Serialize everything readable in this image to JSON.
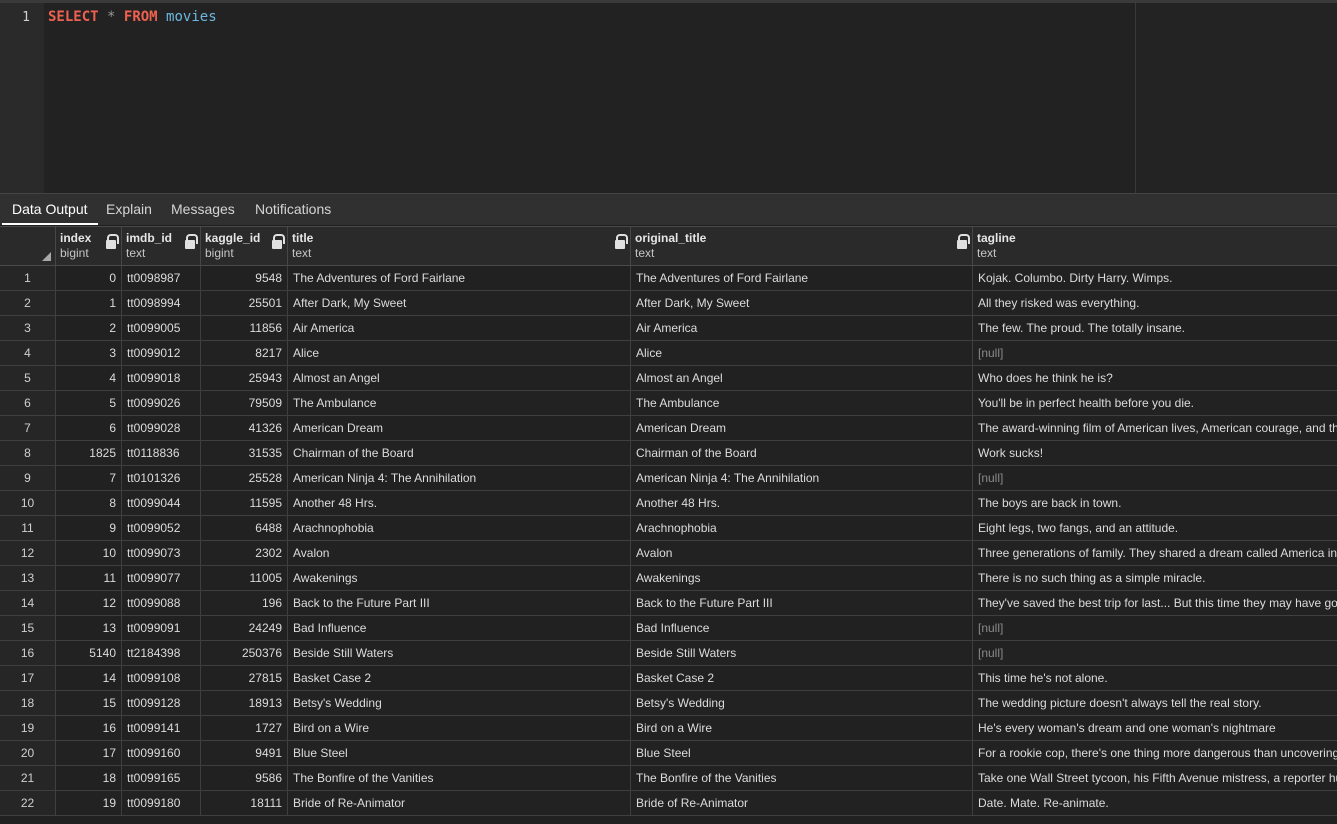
{
  "editor": {
    "line_number": "1",
    "keyword_select": "SELECT",
    "operator_star": "*",
    "keyword_from": "FROM",
    "table_name": "movies"
  },
  "tabs": [
    {
      "label": "Data Output",
      "active": true
    },
    {
      "label": "Explain",
      "active": false
    },
    {
      "label": "Messages",
      "active": false
    },
    {
      "label": "Notifications",
      "active": false
    }
  ],
  "columns": [
    {
      "name": "index",
      "type": "bigint",
      "locked": true
    },
    {
      "name": "imdb_id",
      "type": "text",
      "locked": true
    },
    {
      "name": "kaggle_id",
      "type": "bigint",
      "locked": true
    },
    {
      "name": "title",
      "type": "text",
      "locked": true
    },
    {
      "name": "original_title",
      "type": "text",
      "locked": true
    },
    {
      "name": "tagline",
      "type": "text",
      "locked": false
    }
  ],
  "null_label": "[null]",
  "rows": [
    {
      "n": "1",
      "index": "0",
      "imdb_id": "tt0098987",
      "kaggle_id": "9548",
      "title": "The Adventures of Ford Fairlane",
      "original_title": "The Adventures of Ford Fairlane",
      "tagline": "Kojak. Columbo. Dirty Harry. Wimps."
    },
    {
      "n": "2",
      "index": "1",
      "imdb_id": "tt0098994",
      "kaggle_id": "25501",
      "title": "After Dark, My Sweet",
      "original_title": "After Dark, My Sweet",
      "tagline": "All they risked was everything."
    },
    {
      "n": "3",
      "index": "2",
      "imdb_id": "tt0099005",
      "kaggle_id": "11856",
      "title": "Air America",
      "original_title": "Air America",
      "tagline": "The few. The proud. The totally insane."
    },
    {
      "n": "4",
      "index": "3",
      "imdb_id": "tt0099012",
      "kaggle_id": "8217",
      "title": "Alice",
      "original_title": "Alice",
      "tagline": null
    },
    {
      "n": "5",
      "index": "4",
      "imdb_id": "tt0099018",
      "kaggle_id": "25943",
      "title": "Almost an Angel",
      "original_title": "Almost an Angel",
      "tagline": "Who does he think he is?"
    },
    {
      "n": "6",
      "index": "5",
      "imdb_id": "tt0099026",
      "kaggle_id": "79509",
      "title": "The Ambulance",
      "original_title": "The Ambulance",
      "tagline": "You'll be in perfect health before you die."
    },
    {
      "n": "7",
      "index": "6",
      "imdb_id": "tt0099028",
      "kaggle_id": "41326",
      "title": "American Dream",
      "original_title": "American Dream",
      "tagline": "The award-winning film of American lives, American courage, and th"
    },
    {
      "n": "8",
      "index": "1825",
      "imdb_id": "tt0118836",
      "kaggle_id": "31535",
      "title": "Chairman of the Board",
      "original_title": "Chairman of the Board",
      "tagline": "Work sucks!"
    },
    {
      "n": "9",
      "index": "7",
      "imdb_id": "tt0101326",
      "kaggle_id": "25528",
      "title": "American Ninja 4: The Annihilation",
      "original_title": "American Ninja 4: The Annihilation",
      "tagline": null
    },
    {
      "n": "10",
      "index": "8",
      "imdb_id": "tt0099044",
      "kaggle_id": "11595",
      "title": "Another 48 Hrs.",
      "original_title": "Another 48 Hrs.",
      "tagline": "The boys are back in town."
    },
    {
      "n": "11",
      "index": "9",
      "imdb_id": "tt0099052",
      "kaggle_id": "6488",
      "title": "Arachnophobia",
      "original_title": "Arachnophobia",
      "tagline": "Eight legs, two fangs, and an attitude."
    },
    {
      "n": "12",
      "index": "10",
      "imdb_id": "tt0099073",
      "kaggle_id": "2302",
      "title": "Avalon",
      "original_title": "Avalon",
      "tagline": "Three generations of family. They shared a dream called America in"
    },
    {
      "n": "13",
      "index": "11",
      "imdb_id": "tt0099077",
      "kaggle_id": "11005",
      "title": "Awakenings",
      "original_title": "Awakenings",
      "tagline": "There is no such thing as a simple miracle."
    },
    {
      "n": "14",
      "index": "12",
      "imdb_id": "tt0099088",
      "kaggle_id": "196",
      "title": "Back to the Future Part III",
      "original_title": "Back to the Future Part III",
      "tagline": "They've saved the best trip for last... But this time they may have gor"
    },
    {
      "n": "15",
      "index": "13",
      "imdb_id": "tt0099091",
      "kaggle_id": "24249",
      "title": "Bad Influence",
      "original_title": "Bad Influence",
      "tagline": null
    },
    {
      "n": "16",
      "index": "5140",
      "imdb_id": "tt2184398",
      "kaggle_id": "250376",
      "title": "Beside Still Waters",
      "original_title": "Beside Still Waters",
      "tagline": null
    },
    {
      "n": "17",
      "index": "14",
      "imdb_id": "tt0099108",
      "kaggle_id": "27815",
      "title": "Basket Case 2",
      "original_title": "Basket Case 2",
      "tagline": "This time he's not alone."
    },
    {
      "n": "18",
      "index": "15",
      "imdb_id": "tt0099128",
      "kaggle_id": "18913",
      "title": "Betsy's Wedding",
      "original_title": "Betsy's Wedding",
      "tagline": "The wedding picture doesn't always tell the real story."
    },
    {
      "n": "19",
      "index": "16",
      "imdb_id": "tt0099141",
      "kaggle_id": "1727",
      "title": "Bird on a Wire",
      "original_title": "Bird on a Wire",
      "tagline": "He's every woman's dream and one woman's nightmare"
    },
    {
      "n": "20",
      "index": "17",
      "imdb_id": "tt0099160",
      "kaggle_id": "9491",
      "title": "Blue Steel",
      "original_title": "Blue Steel",
      "tagline": "For a rookie cop, there's one thing more dangerous than uncovering"
    },
    {
      "n": "21",
      "index": "18",
      "imdb_id": "tt0099165",
      "kaggle_id": "9586",
      "title": "The Bonfire of the Vanities",
      "original_title": "The Bonfire of the Vanities",
      "tagline": "Take one Wall Street tycoon, his Fifth Avenue mistress, a reporter hu"
    },
    {
      "n": "22",
      "index": "19",
      "imdb_id": "tt0099180",
      "kaggle_id": "18111",
      "title": "Bride of Re-Animator",
      "original_title": "Bride of Re-Animator",
      "tagline": "Date. Mate. Re-animate."
    }
  ]
}
